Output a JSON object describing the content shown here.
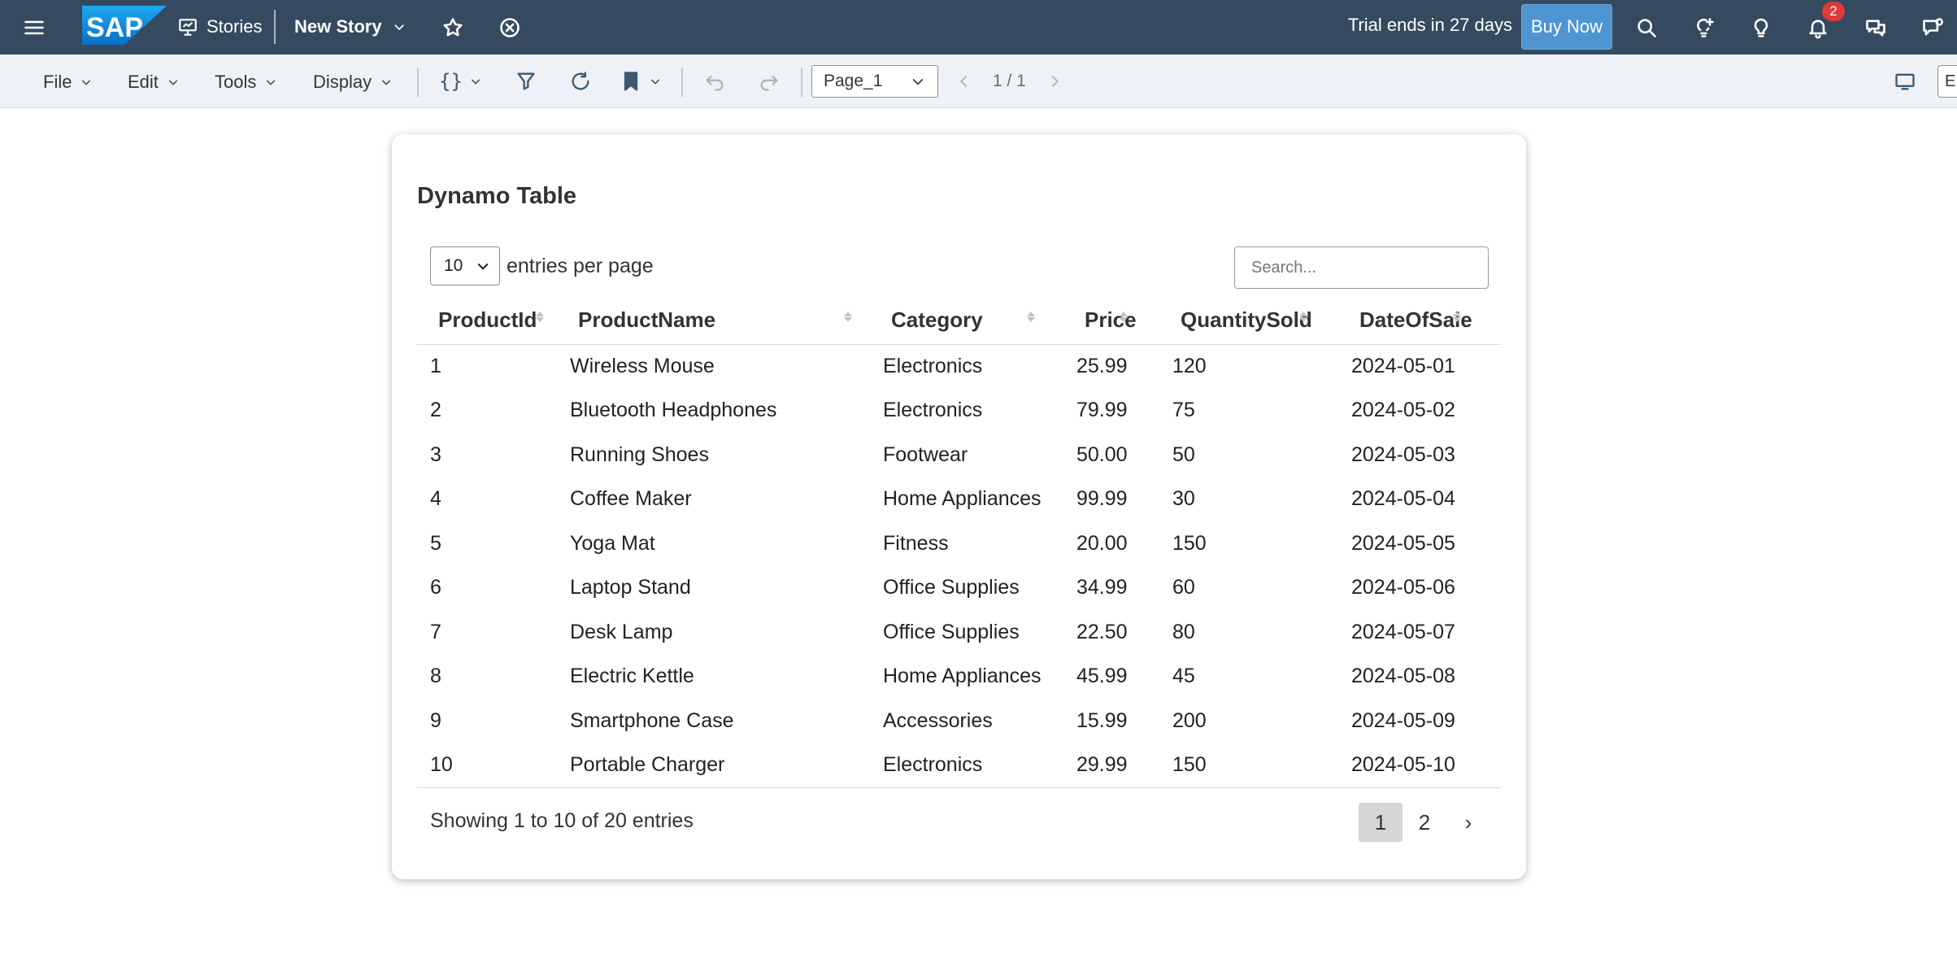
{
  "shell": {
    "logo_text": "SAP",
    "stories_label": "Stories",
    "story_name": "New Story",
    "trial_text": "Trial ends in 27 days",
    "buy_now_label": "Buy Now",
    "notification_count": "2"
  },
  "toolbar": {
    "menus": [
      "File",
      "Edit",
      "Tools",
      "Display"
    ],
    "code_label": "{}",
    "page_select_value": "Page_1",
    "page_count": "1 / 1",
    "edge_label": "E"
  },
  "card": {
    "title": "Dynamo Table",
    "entries_per_page_value": "10",
    "entries_per_page_label": "entries per page",
    "search_placeholder": "Search...",
    "columns": [
      "ProductId",
      "ProductName",
      "Category",
      "Price",
      "QuantitySold",
      "DateOfSale"
    ],
    "rows": [
      [
        "1",
        "Wireless Mouse",
        "Electronics",
        "25.99",
        "120",
        "2024-05-01"
      ],
      [
        "2",
        "Bluetooth Headphones",
        "Electronics",
        "79.99",
        "75",
        "2024-05-02"
      ],
      [
        "3",
        "Running Shoes",
        "Footwear",
        "50.00",
        "50",
        "2024-05-03"
      ],
      [
        "4",
        "Coffee Maker",
        "Home Appliances",
        "99.99",
        "30",
        "2024-05-04"
      ],
      [
        "5",
        "Yoga Mat",
        "Fitness",
        "20.00",
        "150",
        "2024-05-05"
      ],
      [
        "6",
        "Laptop Stand",
        "Office Supplies",
        "34.99",
        "60",
        "2024-05-06"
      ],
      [
        "7",
        "Desk Lamp",
        "Office Supplies",
        "22.50",
        "80",
        "2024-05-07"
      ],
      [
        "8",
        "Electric Kettle",
        "Home Appliances",
        "45.99",
        "45",
        "2024-05-08"
      ],
      [
        "9",
        "Smartphone Case",
        "Accessories",
        "15.99",
        "200",
        "2024-05-09"
      ],
      [
        "10",
        "Portable Charger",
        "Electronics",
        "29.99",
        "150",
        "2024-05-10"
      ]
    ],
    "footer_info": "Showing 1 to 10 of 20 entries",
    "pages": [
      "1",
      "2"
    ],
    "next_label": "›"
  }
}
